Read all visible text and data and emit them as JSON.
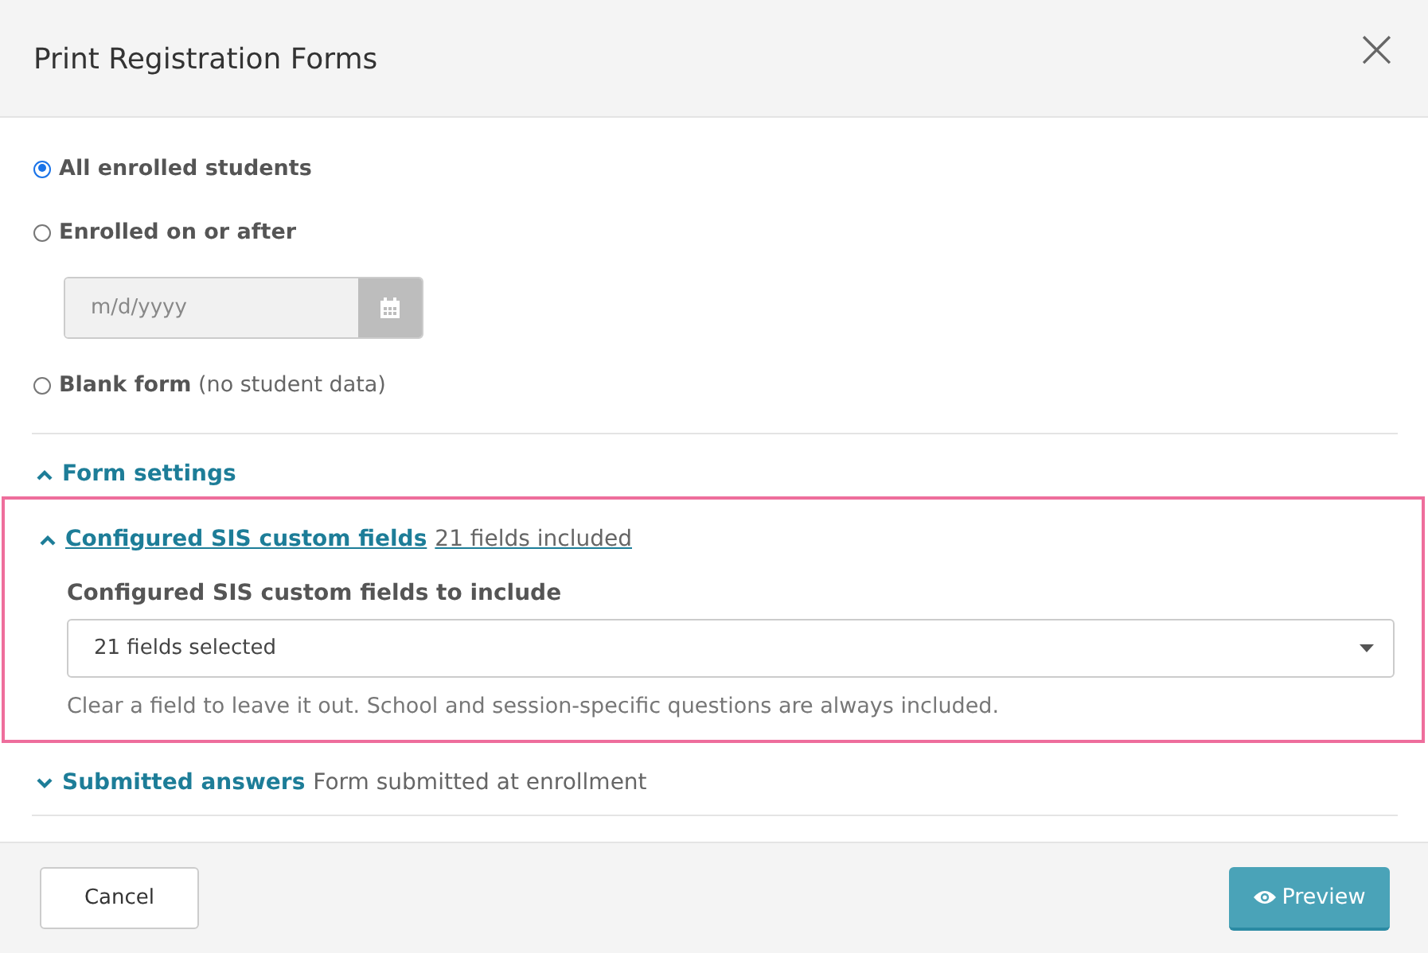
{
  "dialog": {
    "title": "Print Registration Forms",
    "close_label": "×"
  },
  "options": [
    {
      "kind": "plain",
      "label": "All enrolled students",
      "selected": true
    },
    {
      "kind": "date",
      "label": "Enrolled on or after",
      "selected": false,
      "placeholder": "m/d/yyyy"
    },
    {
      "kind": "note",
      "label": "Blank form",
      "note": "(no student data)",
      "selected": false
    }
  ],
  "sections": [
    {
      "title": "Form settings",
      "expanded": true,
      "highlighted": false
    },
    {
      "title": "Configured SIS custom fields",
      "summary": "21 fields included",
      "expanded": true,
      "highlighted": true,
      "field_label": "Configured SIS custom fields to include",
      "select_value": "21 fields selected",
      "help": "Clear a field to leave it out. School and session-specific questions are always included."
    },
    {
      "title": "Submitted answers",
      "summary": "Form submitted at enrollment",
      "expanded": false,
      "highlighted": false
    }
  ],
  "buttons": {
    "cancel": "Cancel",
    "preview": "Preview"
  }
}
